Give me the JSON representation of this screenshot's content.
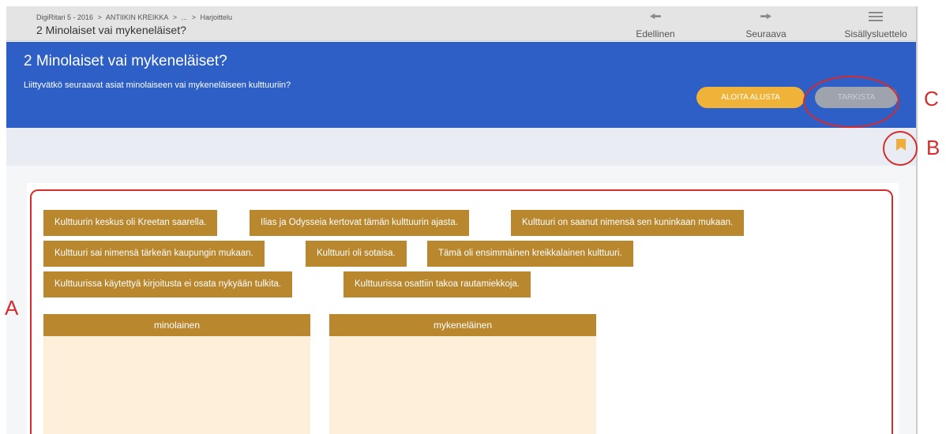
{
  "topbar": {
    "breadcrumb": [
      "DigiRitari 5 - 2016",
      ">",
      "ANTIIKIN KREIKKA",
      ">",
      "...",
      ">",
      "Harjoittelu"
    ],
    "title": "2 Minolaiset vai mykeneläiset?",
    "nav": {
      "prev_label": "Edellinen",
      "next_label": "Seuraava",
      "toc_label": "Sisällysluettelo"
    }
  },
  "header": {
    "title": "2 Minolaiset vai mykeneläiset?",
    "question": "Liittyvätkö seuraavat asiat minolaiseen vai mykeneläiseen kulttuuriin?",
    "restart_label": "ALOITA ALUSTA",
    "check_label": "TARKISTA"
  },
  "items": [
    "Kulttuurin keskus oli Kreetan saarella.",
    "Ilias ja Odysseia kertovat tämän kulttuurin ajasta.",
    "Kulttuuri on saanut nimensä sen kuninkaan mukaan.",
    "Kulttuuri sai nimensä tärkeän kaupungin mukaan.",
    "Kulttuuri oli sotaisa.",
    "Tämä oli ensimmäinen kreikkalainen kulttuuri.",
    "Kulttuurissa käytettyä kirjoitusta ei osata nykyään tulkita.",
    "Kulttuurissa osattiin takoa rautamiekkoja."
  ],
  "dropzones": [
    "minolainen",
    "mykeneläinen"
  ],
  "annotations": {
    "a": "A",
    "b": "B",
    "c": "C"
  },
  "colors": {
    "header_blue": "#2e5fc6",
    "item_brown": "#b8872e",
    "restart_orange": "#f0b339",
    "annotation_red": "#d52c2c"
  }
}
